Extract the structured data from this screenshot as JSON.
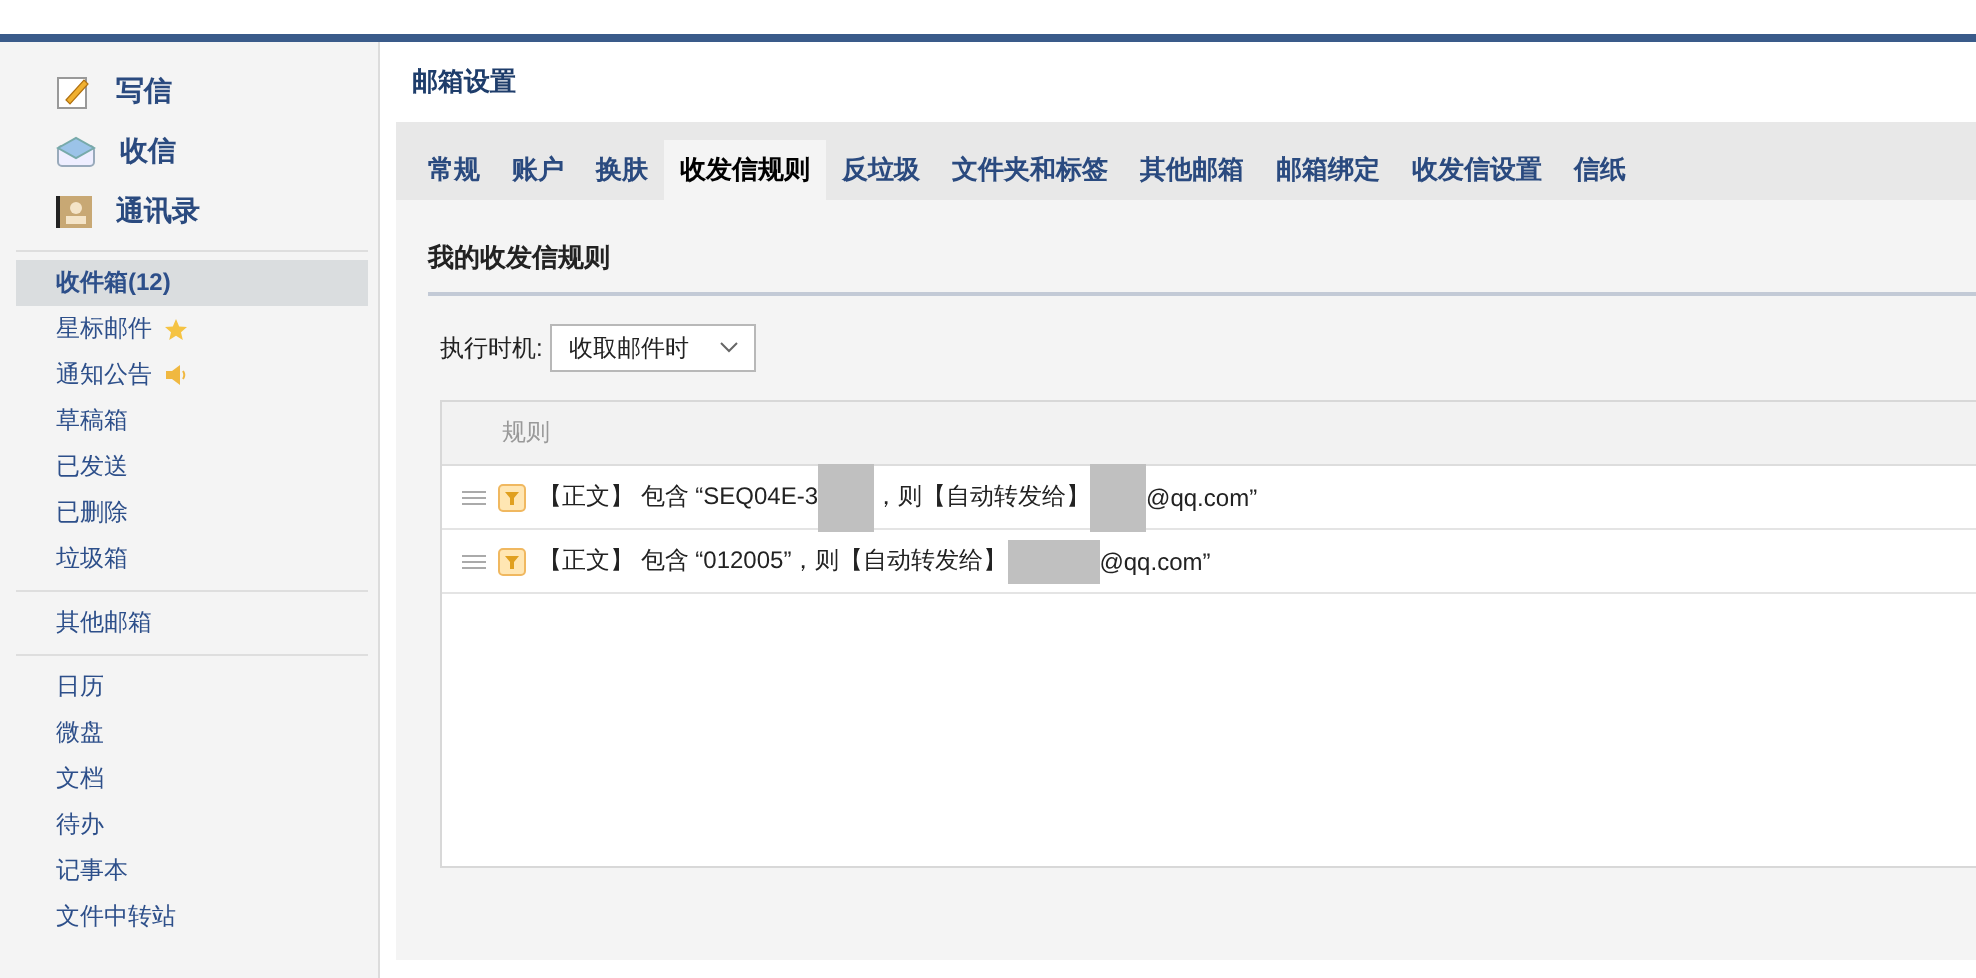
{
  "sidebar": {
    "actions": [
      {
        "kind": "compose",
        "label": "写信"
      },
      {
        "kind": "inbox",
        "label": "收信"
      },
      {
        "kind": "contacts",
        "label": "通讯录"
      }
    ],
    "groups": [
      [
        {
          "label": "收件箱(12)",
          "selected": true
        },
        {
          "label": "星标邮件",
          "kind": "starred",
          "selected": false
        },
        {
          "label": "通知公告",
          "kind": "notice",
          "selected": false
        },
        {
          "label": "草稿箱",
          "selected": false
        },
        {
          "label": "已发送",
          "selected": false
        },
        {
          "label": "已删除",
          "selected": false
        },
        {
          "label": "垃圾箱",
          "selected": false
        }
      ],
      [
        {
          "label": "其他邮箱",
          "selected": false
        }
      ],
      [
        {
          "label": "日历",
          "selected": false
        },
        {
          "label": "微盘",
          "selected": false
        },
        {
          "label": "文档",
          "selected": false
        },
        {
          "label": "待办",
          "selected": false
        },
        {
          "label": "记事本",
          "selected": false
        },
        {
          "label": "文件中转站",
          "selected": false
        }
      ]
    ]
  },
  "page_title": "邮箱设置",
  "tabs": [
    {
      "label": "常规",
      "selected": false
    },
    {
      "label": "账户",
      "selected": false
    },
    {
      "label": "换肤",
      "selected": false
    },
    {
      "label": "收发信规则",
      "selected": true
    },
    {
      "label": "反垃圾",
      "selected": false
    },
    {
      "label": "文件夹和标签",
      "selected": false
    },
    {
      "label": "其他邮箱",
      "selected": false
    },
    {
      "label": "邮箱绑定",
      "selected": false
    },
    {
      "label": "收发信设置",
      "selected": false
    },
    {
      "label": "信纸",
      "selected": false
    }
  ],
  "section_title": "我的收发信规则",
  "timing": {
    "label": "执行时机:",
    "value": "收取邮件时"
  },
  "table": {
    "columns": [
      "规则"
    ],
    "rows": [
      {
        "segments": [
          {
            "kind": "text",
            "text": "【正文】 包含 “SEQ04E-3"
          },
          {
            "kind": "redacted"
          },
          {
            "kind": "text",
            "text": "，则【自动转发给】"
          },
          {
            "kind": "redacted"
          },
          {
            "kind": "text",
            "text": "@qq.com”"
          }
        ]
      },
      {
        "segments": [
          {
            "kind": "text",
            "text": "【正文】 包含 “012005”，则【自动转发给】"
          },
          {
            "kind": "redacted"
          },
          {
            "kind": "text",
            "text": "@qq.com”"
          }
        ]
      }
    ]
  }
}
